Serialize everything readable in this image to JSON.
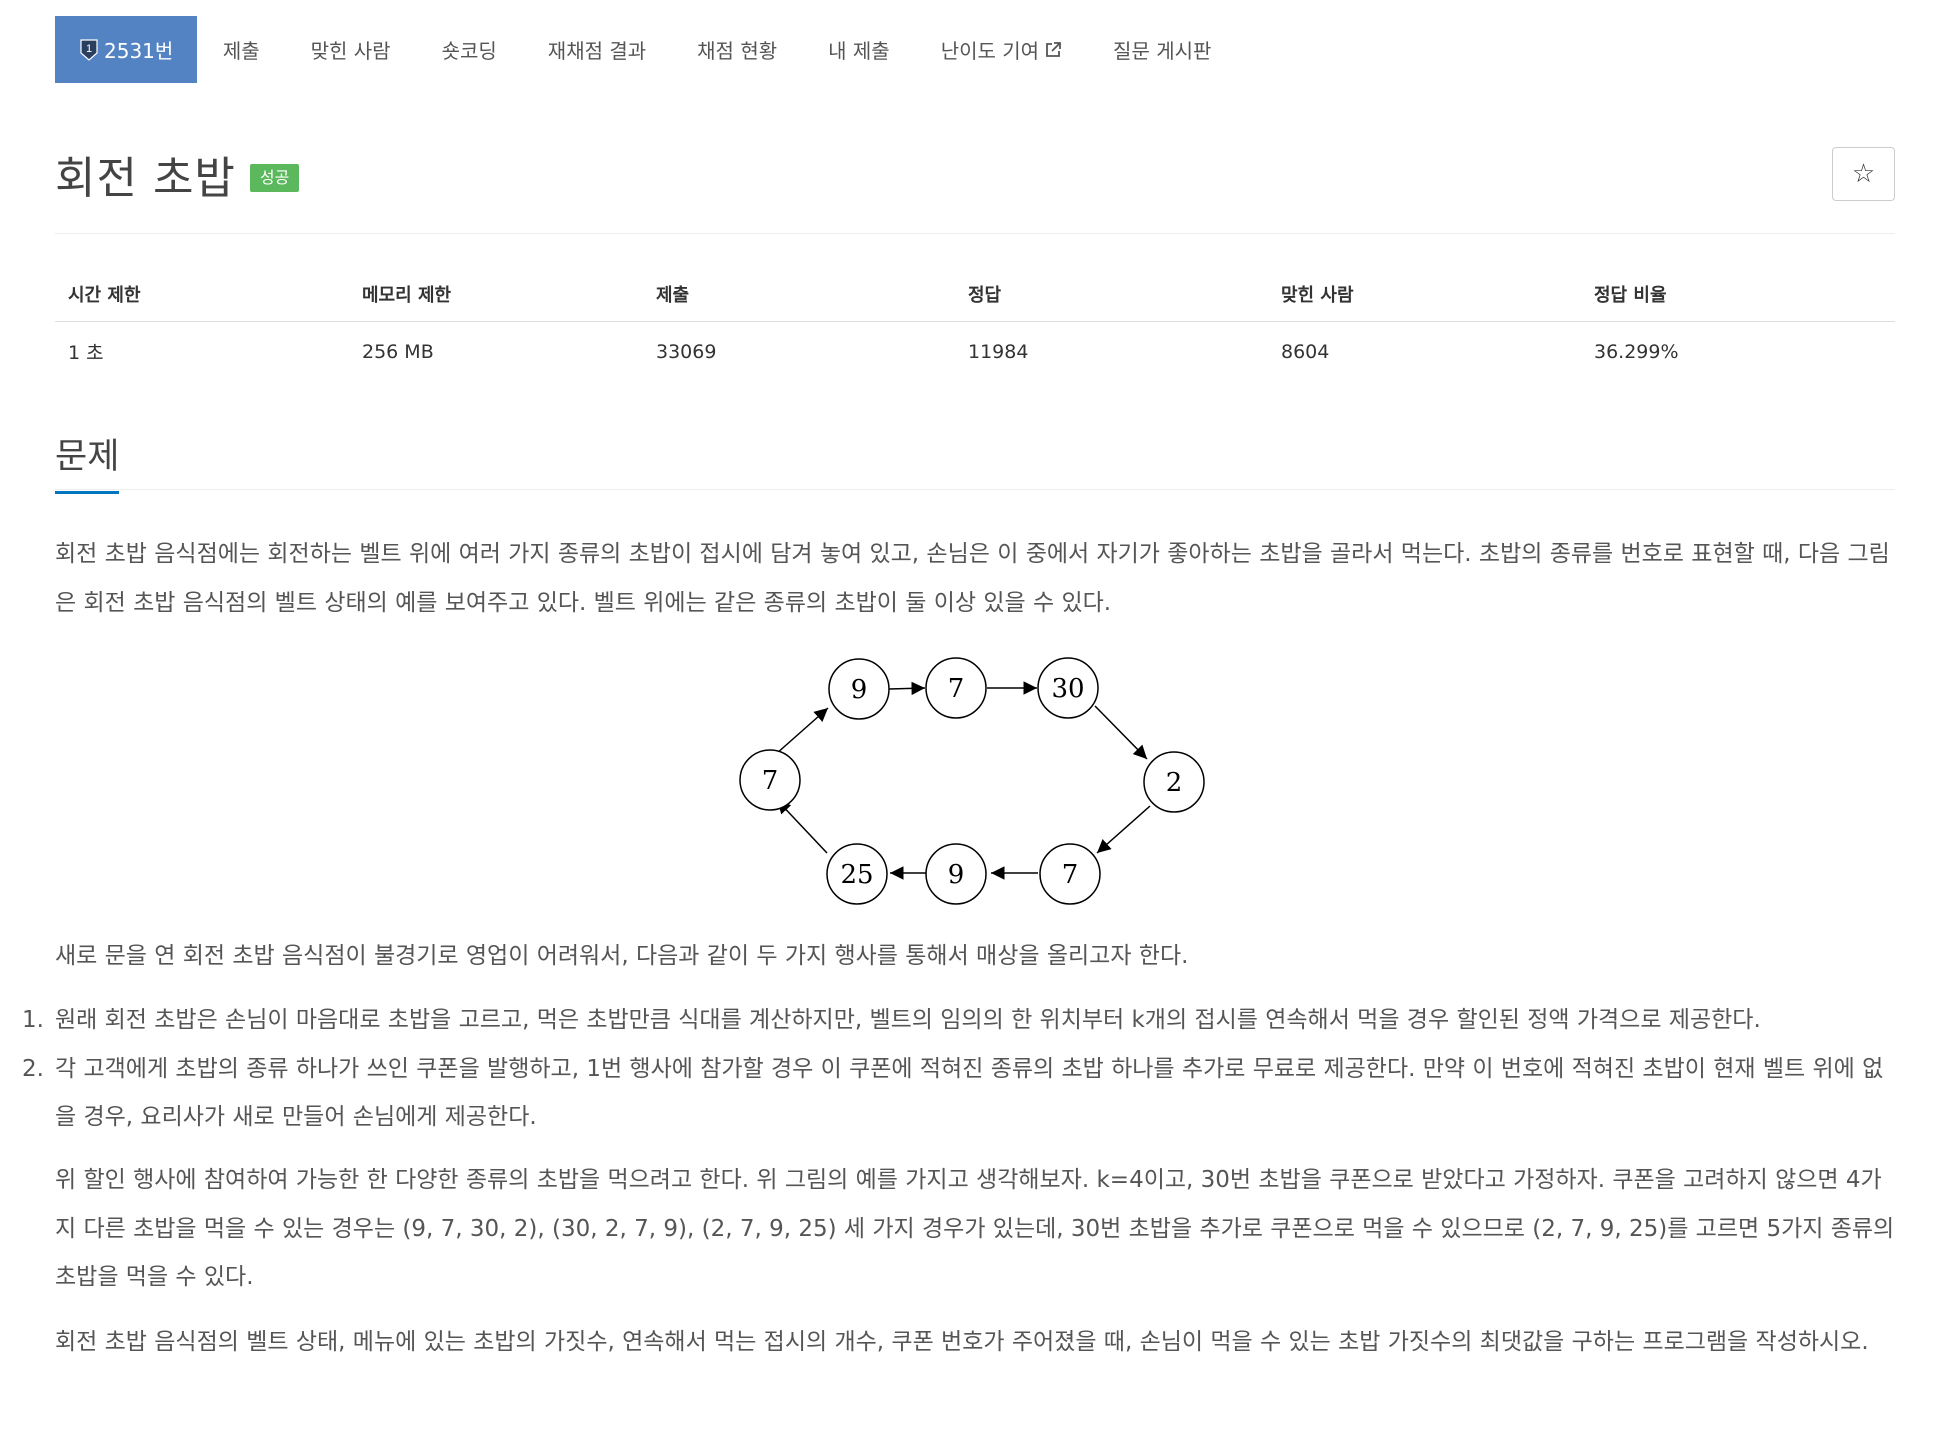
{
  "tabs": [
    {
      "label": "2531번",
      "active": true,
      "tier_icon_text": "1"
    },
    {
      "label": "제출"
    },
    {
      "label": "맞힌 사람"
    },
    {
      "label": "숏코딩"
    },
    {
      "label": "재채점 결과"
    },
    {
      "label": "채점 현황"
    },
    {
      "label": "내 제출"
    },
    {
      "label": "난이도 기여",
      "icon": "external-link-icon"
    },
    {
      "label": "질문 게시판"
    }
  ],
  "problem": {
    "title": "회전 초밥",
    "badge": "성공",
    "star_button": "☆"
  },
  "info_table": {
    "headers": [
      "시간 제한",
      "메모리 제한",
      "제출",
      "정답",
      "맞힌 사람",
      "정답 비율"
    ],
    "values": [
      "1 초",
      "256 MB",
      "33069",
      "11984",
      "8604",
      "36.299%"
    ]
  },
  "section": {
    "title": "문제",
    "p1": "회전 초밥 음식점에는 회전하는 벨트 위에 여러 가지 종류의 초밥이 접시에 담겨 놓여 있고, 손님은 이 중에서 자기가 좋아하는 초밥을 골라서 먹는다. 초밥의 종류를 번호로 표현할 때, 다음 그림은 회전 초밥 음식점의 벨트 상태의 예를 보여주고 있다. 벨트 위에는 같은 종류의 초밥이 둘 이상 있을 수 있다.",
    "p2": "새로 문을 연 회전 초밥 음식점이 불경기로 영업이 어려워서, 다음과 같이 두 가지 행사를 통해서 매상을 올리고자 한다.",
    "list": [
      {
        "num": "1.",
        "text": "원래 회전 초밥은 손님이 마음대로 초밥을 고르고, 먹은 초밥만큼 식대를 계산하지만, 벨트의 임의의 한 위치부터 k개의 접시를 연속해서 먹을 경우 할인된 정액 가격으로 제공한다."
      },
      {
        "num": "2.",
        "text": "각 고객에게 초밥의 종류 하나가 쓰인 쿠폰을 발행하고, 1번 행사에 참가할 경우 이 쿠폰에 적혀진 종류의 초밥 하나를 추가로 무료로 제공한다. 만약 이 번호에 적혀진 초밥이 현재 벨트 위에 없을 경우, 요리사가 새로 만들어 손님에게 제공한다."
      }
    ],
    "p3": "위 할인 행사에 참여하여 가능한 한 다양한 종류의 초밥을 먹으려고 한다. 위 그림의 예를 가지고 생각해보자. k=4이고, 30번 초밥을 쿠폰으로 받았다고 가정하자. 쿠폰을 고려하지 않으면 4가지 다른 초밥을 먹을 수 있는 경우는 (9, 7, 30, 2), (30, 2, 7, 9), (2, 7, 9, 25) 세 가지 경우가 있는데, 30번 초밥을 추가로 쿠폰으로 먹을 수 있으므로 (2, 7, 9, 25)를 고르면 5가지 종류의 초밥을 먹을 수 있다.",
    "p4": "회전 초밥 음식점의 벨트 상태, 메뉴에 있는 초밥의 가짓수, 연속해서 먹는 접시의 개수, 쿠폰 번호가 주어졌을 때, 손님이 먹을 수 있는 초밥 가짓수의 최댓값을 구하는 프로그램을 작성하시오."
  },
  "diagram": {
    "nodes": [
      "9",
      "7",
      "30",
      "2",
      "7",
      "9",
      "25",
      "7"
    ]
  },
  "colors": {
    "active_tab": "#5383c3",
    "success_badge": "#5cb85c",
    "section_underline": "#0076c0"
  }
}
